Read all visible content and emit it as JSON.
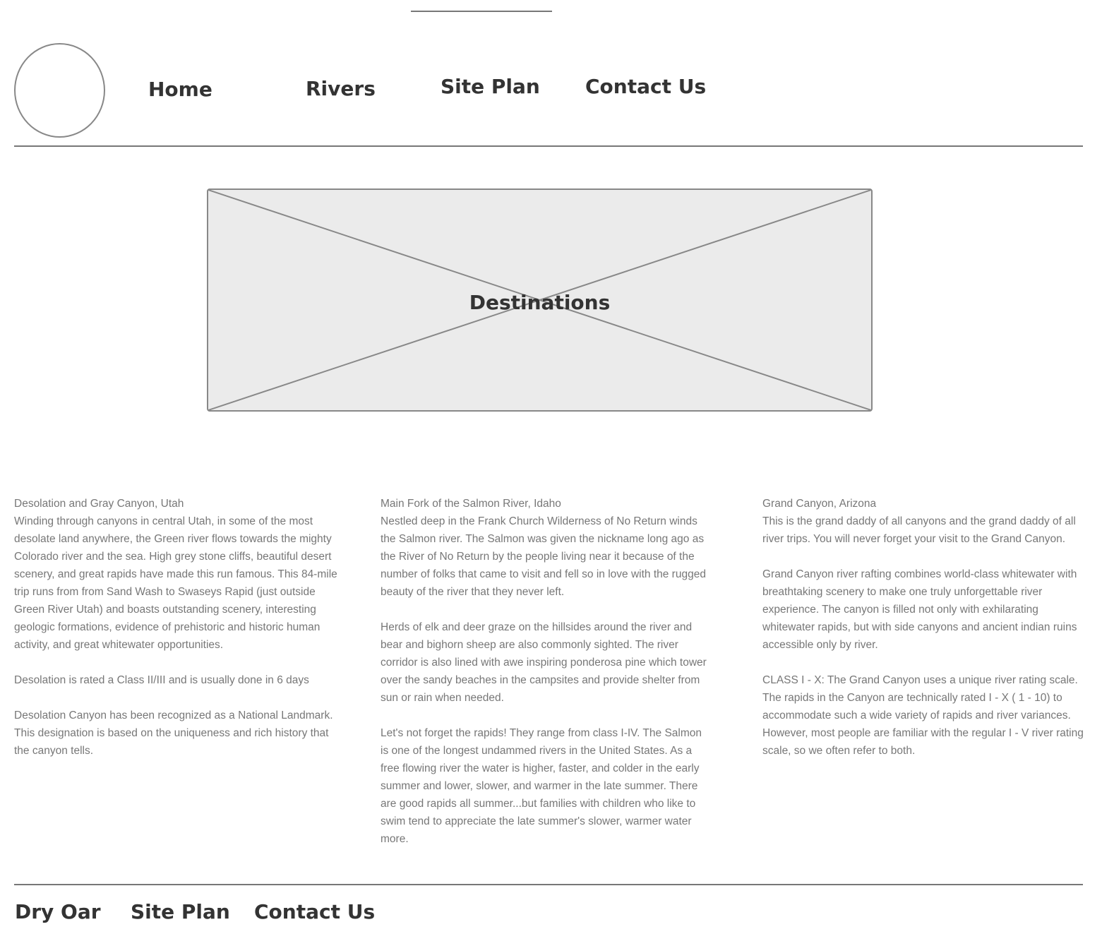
{
  "nav": {
    "home": "Home",
    "rivers": "Rivers",
    "site_plan": "Site Plan",
    "contact": "Contact Us"
  },
  "hero": {
    "title": "Destinations"
  },
  "columns": [
    {
      "heading": "Desolation and Gray Canyon, Utah",
      "paragraphs": [
        "Winding through canyons in central Utah, in some of the most desolate land anywhere, the Green river flows towards the mighty Colorado river and the sea. High grey stone cliffs, beautiful desert scenery, and great rapids have made this run famous. This 84-mile trip runs from from Sand Wash to Swaseys Rapid (just outside Green River Utah) and boasts outstanding scenery, interesting geologic formations, evidence of prehistoric and historic human activity, and great whitewater opportunities.",
        "Desolation is rated a Class II/III and is usually done in 6 days",
        "Desolation Canyon has been recognized as a National Landmark.  This designation is based on the uniqueness and rich history that the canyon tells."
      ]
    },
    {
      "heading": "Main Fork of the Salmon River, Idaho",
      "paragraphs": [
        "Nestled deep in the Frank Church Wilderness of No Return winds the Salmon river. The Salmon was given the nickname long ago as the River of No Return by the people living near it because of the number of folks that came to visit and fell so in love with the rugged beauty of the river that they never left.",
        "Herds of elk and deer graze on the hillsides around the river and bear and bighorn sheep are also commonly sighted. The river corridor is also lined with awe inspiring ponderosa pine which tower over the sandy beaches in the campsites and provide shelter from sun or rain when needed.",
        "Let's not forget the rapids! They range from class I-IV. The Salmon is one of the longest undammed rivers in the United States. As a free flowing river the water is higher, faster, and colder in the early summer and lower, slower, and warmer in the late summer. There are good rapids all summer...but families with children who like to swim tend to appreciate the late summer's slower, warmer water more."
      ]
    },
    {
      "heading": "Grand Canyon, Arizona",
      "paragraphs": [
        "This is the grand daddy of all canyons and the grand daddy of all river trips. You will never forget your visit to the Grand Canyon.",
        "Grand Canyon river rafting combines world-class whitewater with breathtaking scenery to make one truly unforgettable river experience. The canyon is filled not only with exhilarating whitewater rapids, but with side canyons and ancient indian ruins accessible only by river.",
        "CLASS I - X: The Grand Canyon uses a unique river rating scale. The rapids in the Canyon are technically rated I - X ( 1 - 10) to accommodate such a wide variety of rapids and river variances. However, most people are familiar with the regular I - V river rating scale, so we often refer to both."
      ]
    }
  ],
  "footer": {
    "brand": "Dry Oar",
    "site_plan": "Site Plan",
    "contact": "Contact Us"
  }
}
